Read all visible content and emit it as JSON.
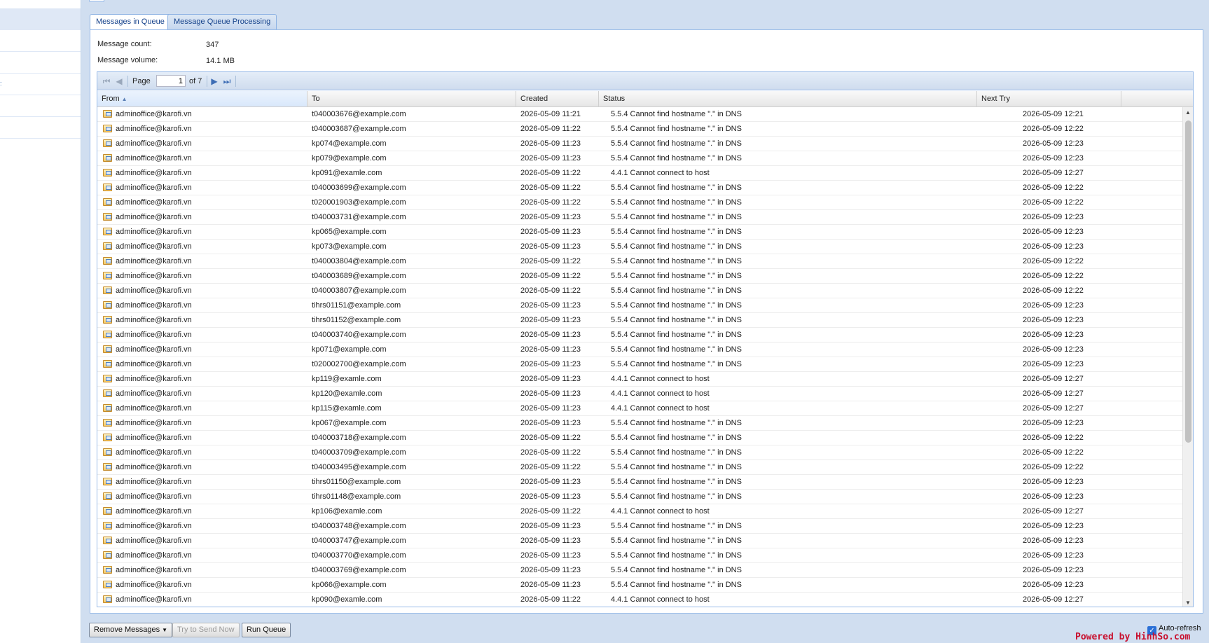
{
  "tabs": [
    {
      "label": "Messages in Queue"
    },
    {
      "label": "Message Queue Processing"
    }
  ],
  "summary": {
    "count_label": "Message count:",
    "count_value": "347",
    "volume_label": "Message volume:",
    "volume_value": "14.1 MB"
  },
  "pager": {
    "page_label": "Page",
    "page_value": "1",
    "of_label": "of 7"
  },
  "columns": {
    "from": "From",
    "to": "To",
    "created": "Created",
    "status": "Status",
    "next_try": "Next Try"
  },
  "messages": [
    {
      "from": "adminoffice@karofi.vn",
      "to": "t040003676@example.com",
      "created": "2026-05-09 11:21",
      "status": "5.5.4 Cannot find hostname \".\" in DNS",
      "next": "2026-05-09 12:21"
    },
    {
      "from": "adminoffice@karofi.vn",
      "to": "t040003687@example.com",
      "created": "2026-05-09 11:22",
      "status": "5.5.4 Cannot find hostname \".\" in DNS",
      "next": "2026-05-09 12:22"
    },
    {
      "from": "adminoffice@karofi.vn",
      "to": "kp074@example.com",
      "created": "2026-05-09 11:23",
      "status": "5.5.4 Cannot find hostname \".\" in DNS",
      "next": "2026-05-09 12:23"
    },
    {
      "from": "adminoffice@karofi.vn",
      "to": "kp079@example.com",
      "created": "2026-05-09 11:23",
      "status": "5.5.4 Cannot find hostname \".\" in DNS",
      "next": "2026-05-09 12:23"
    },
    {
      "from": "adminoffice@karofi.vn",
      "to": "kp091@examle.com",
      "created": "2026-05-09 11:22",
      "status": "4.4.1 Cannot connect to host",
      "next": "2026-05-09 12:27"
    },
    {
      "from": "adminoffice@karofi.vn",
      "to": "t040003699@example.com",
      "created": "2026-05-09 11:22",
      "status": "5.5.4 Cannot find hostname \".\" in DNS",
      "next": "2026-05-09 12:22"
    },
    {
      "from": "adminoffice@karofi.vn",
      "to": "t020001903@example.com",
      "created": "2026-05-09 11:22",
      "status": "5.5.4 Cannot find hostname \".\" in DNS",
      "next": "2026-05-09 12:22"
    },
    {
      "from": "adminoffice@karofi.vn",
      "to": "t040003731@example.com",
      "created": "2026-05-09 11:23",
      "status": "5.5.4 Cannot find hostname \".\" in DNS",
      "next": "2026-05-09 12:23"
    },
    {
      "from": "adminoffice@karofi.vn",
      "to": "kp065@example.com",
      "created": "2026-05-09 11:23",
      "status": "5.5.4 Cannot find hostname \".\" in DNS",
      "next": "2026-05-09 12:23"
    },
    {
      "from": "adminoffice@karofi.vn",
      "to": "kp073@example.com",
      "created": "2026-05-09 11:23",
      "status": "5.5.4 Cannot find hostname \".\" in DNS",
      "next": "2026-05-09 12:23"
    },
    {
      "from": "adminoffice@karofi.vn",
      "to": "t040003804@example.com",
      "created": "2026-05-09 11:22",
      "status": "5.5.4 Cannot find hostname \".\" in DNS",
      "next": "2026-05-09 12:22"
    },
    {
      "from": "adminoffice@karofi.vn",
      "to": "t040003689@example.com",
      "created": "2026-05-09 11:22",
      "status": "5.5.4 Cannot find hostname \".\" in DNS",
      "next": "2026-05-09 12:22"
    },
    {
      "from": "adminoffice@karofi.vn",
      "to": "t040003807@example.com",
      "created": "2026-05-09 11:22",
      "status": "5.5.4 Cannot find hostname \".\" in DNS",
      "next": "2026-05-09 12:22"
    },
    {
      "from": "adminoffice@karofi.vn",
      "to": "tihrs01151@example.com",
      "created": "2026-05-09 11:23",
      "status": "5.5.4 Cannot find hostname \".\" in DNS",
      "next": "2026-05-09 12:23"
    },
    {
      "from": "adminoffice@karofi.vn",
      "to": "tihrs01152@example.com",
      "created": "2026-05-09 11:23",
      "status": "5.5.4 Cannot find hostname \".\" in DNS",
      "next": "2026-05-09 12:23"
    },
    {
      "from": "adminoffice@karofi.vn",
      "to": "t040003740@example.com",
      "created": "2026-05-09 11:23",
      "status": "5.5.4 Cannot find hostname \".\" in DNS",
      "next": "2026-05-09 12:23"
    },
    {
      "from": "adminoffice@karofi.vn",
      "to": "kp071@example.com",
      "created": "2026-05-09 11:23",
      "status": "5.5.4 Cannot find hostname \".\" in DNS",
      "next": "2026-05-09 12:23"
    },
    {
      "from": "adminoffice@karofi.vn",
      "to": "t020002700@example.com",
      "created": "2026-05-09 11:23",
      "status": "5.5.4 Cannot find hostname \".\" in DNS",
      "next": "2026-05-09 12:23"
    },
    {
      "from": "adminoffice@karofi.vn",
      "to": "kp119@examle.com",
      "created": "2026-05-09 11:23",
      "status": "4.4.1 Cannot connect to host",
      "next": "2026-05-09 12:27"
    },
    {
      "from": "adminoffice@karofi.vn",
      "to": "kp120@examle.com",
      "created": "2026-05-09 11:23",
      "status": "4.4.1 Cannot connect to host",
      "next": "2026-05-09 12:27"
    },
    {
      "from": "adminoffice@karofi.vn",
      "to": "kp115@examle.com",
      "created": "2026-05-09 11:23",
      "status": "4.4.1 Cannot connect to host",
      "next": "2026-05-09 12:27"
    },
    {
      "from": "adminoffice@karofi.vn",
      "to": "kp067@example.com",
      "created": "2026-05-09 11:23",
      "status": "5.5.4 Cannot find hostname \".\" in DNS",
      "next": "2026-05-09 12:23"
    },
    {
      "from": "adminoffice@karofi.vn",
      "to": "t040003718@example.com",
      "created": "2026-05-09 11:22",
      "status": "5.5.4 Cannot find hostname \".\" in DNS",
      "next": "2026-05-09 12:22"
    },
    {
      "from": "adminoffice@karofi.vn",
      "to": "t040003709@example.com",
      "created": "2026-05-09 11:22",
      "status": "5.5.4 Cannot find hostname \".\" in DNS",
      "next": "2026-05-09 12:22"
    },
    {
      "from": "adminoffice@karofi.vn",
      "to": "t040003495@example.com",
      "created": "2026-05-09 11:22",
      "status": "5.5.4 Cannot find hostname \".\" in DNS",
      "next": "2026-05-09 12:22"
    },
    {
      "from": "adminoffice@karofi.vn",
      "to": "tihrs01150@example.com",
      "created": "2026-05-09 11:23",
      "status": "5.5.4 Cannot find hostname \".\" in DNS",
      "next": "2026-05-09 12:23"
    },
    {
      "from": "adminoffice@karofi.vn",
      "to": "tihrs01148@example.com",
      "created": "2026-05-09 11:23",
      "status": "5.5.4 Cannot find hostname \".\" in DNS",
      "next": "2026-05-09 12:23"
    },
    {
      "from": "adminoffice@karofi.vn",
      "to": "kp106@examle.com",
      "created": "2026-05-09 11:22",
      "status": "4.4.1 Cannot connect to host",
      "next": "2026-05-09 12:27"
    },
    {
      "from": "adminoffice@karofi.vn",
      "to": "t040003748@example.com",
      "created": "2026-05-09 11:23",
      "status": "5.5.4 Cannot find hostname \".\" in DNS",
      "next": "2026-05-09 12:23"
    },
    {
      "from": "adminoffice@karofi.vn",
      "to": "t040003747@example.com",
      "created": "2026-05-09 11:23",
      "status": "5.5.4 Cannot find hostname \".\" in DNS",
      "next": "2026-05-09 12:23"
    },
    {
      "from": "adminoffice@karofi.vn",
      "to": "t040003770@example.com",
      "created": "2026-05-09 11:23",
      "status": "5.5.4 Cannot find hostname \".\" in DNS",
      "next": "2026-05-09 12:23"
    },
    {
      "from": "adminoffice@karofi.vn",
      "to": "t040003769@example.com",
      "created": "2026-05-09 11:23",
      "status": "5.5.4 Cannot find hostname \".\" in DNS",
      "next": "2026-05-09 12:23"
    },
    {
      "from": "adminoffice@karofi.vn",
      "to": "kp066@example.com",
      "created": "2026-05-09 11:23",
      "status": "5.5.4 Cannot find hostname \".\" in DNS",
      "next": "2026-05-09 12:23"
    },
    {
      "from": "adminoffice@karofi.vn",
      "to": "kp090@examle.com",
      "created": "2026-05-09 11:22",
      "status": "4.4.1 Cannot connect to host",
      "next": "2026-05-09 12:27"
    }
  ],
  "footer": {
    "remove_label": "Remove Messages",
    "try_label": "Try to Send Now",
    "run_label": "Run Queue",
    "autorefresh_label": "Auto-refresh"
  },
  "watermark": "Powered by HinhSo.com",
  "colors": {
    "accent": "#15428b",
    "panel_border": "#99bbe8",
    "background": "#d0def0",
    "watermark": "#c8102e"
  }
}
